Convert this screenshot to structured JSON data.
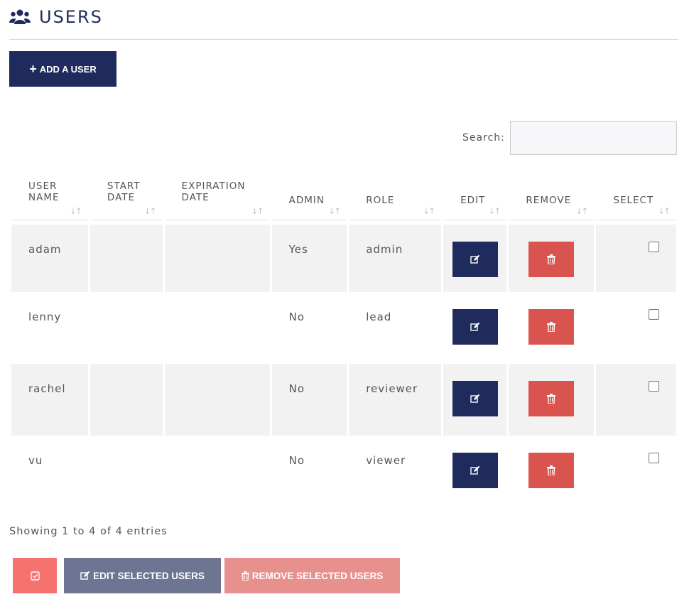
{
  "page": {
    "title": "USERS",
    "icon": "users-icon"
  },
  "toolbar": {
    "add_label": "ADD A USER"
  },
  "search": {
    "label": "Search:",
    "value": "",
    "placeholder": ""
  },
  "table": {
    "columns": [
      "USER NAME",
      "START DATE",
      "EXPIRATION DATE",
      "ADMIN",
      "ROLE",
      "EDIT",
      "REMOVE",
      "SELECT"
    ],
    "rows": [
      {
        "user": "adam",
        "start": "",
        "expiration": "",
        "admin": "Yes",
        "role": "admin",
        "selected": false
      },
      {
        "user": "lenny",
        "start": "",
        "expiration": "",
        "admin": "No",
        "role": "lead",
        "selected": false
      },
      {
        "user": "rachel",
        "start": "",
        "expiration": "",
        "admin": "No",
        "role": "reviewer",
        "selected": false
      },
      {
        "user": "vu",
        "start": "",
        "expiration": "",
        "admin": "No",
        "role": "viewer",
        "selected": false
      }
    ]
  },
  "info": "Showing 1 to 4 of 4 entries",
  "bottom": {
    "edit_label": "EDIT SELECTED USERS",
    "remove_label": "REMOVE SELECTED USERS"
  },
  "colors": {
    "primary": "#1f2b5c",
    "danger": "#d9534f",
    "select_all": "#f5726f",
    "edit_selected": "#6e7592",
    "remove_selected": "#e8908d"
  }
}
